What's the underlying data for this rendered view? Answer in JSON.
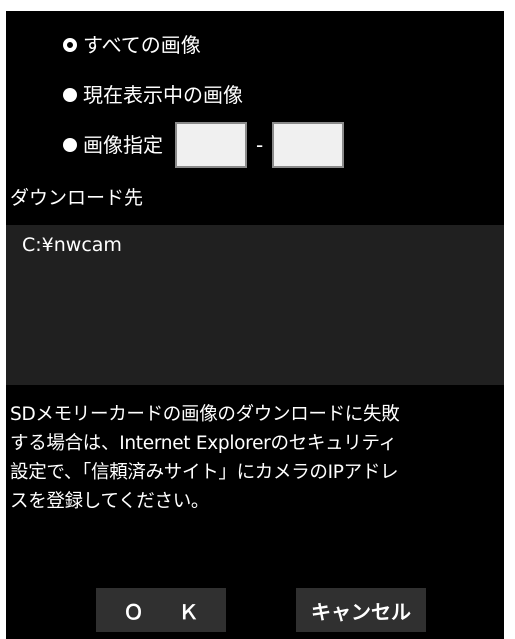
{
  "download_options": {
    "options": [
      {
        "label": "すべての画像",
        "checked": true
      },
      {
        "label": "現在表示中の画像",
        "checked": false
      },
      {
        "label": "画像指定",
        "checked": false
      }
    ],
    "range": {
      "from_value": "",
      "to_value": "",
      "separator": "-"
    }
  },
  "destination": {
    "label": "ダウンロード先",
    "path": "C:¥nwcam"
  },
  "notice": {
    "text": "SDメモリーカードの画像のダウンロードに失敗\nする場合は、Internet Explorerのセキュリティ\n設定で、「信頼済みサイト」にカメラのIPアドレ\nスを登録してください。"
  },
  "buttons": {
    "ok_label": "Ｏ Ｋ",
    "cancel_label": "キャンセル"
  },
  "colors": {
    "background": "#000000",
    "text": "#ffffff",
    "path_box": "#202020",
    "button": "#303030"
  }
}
